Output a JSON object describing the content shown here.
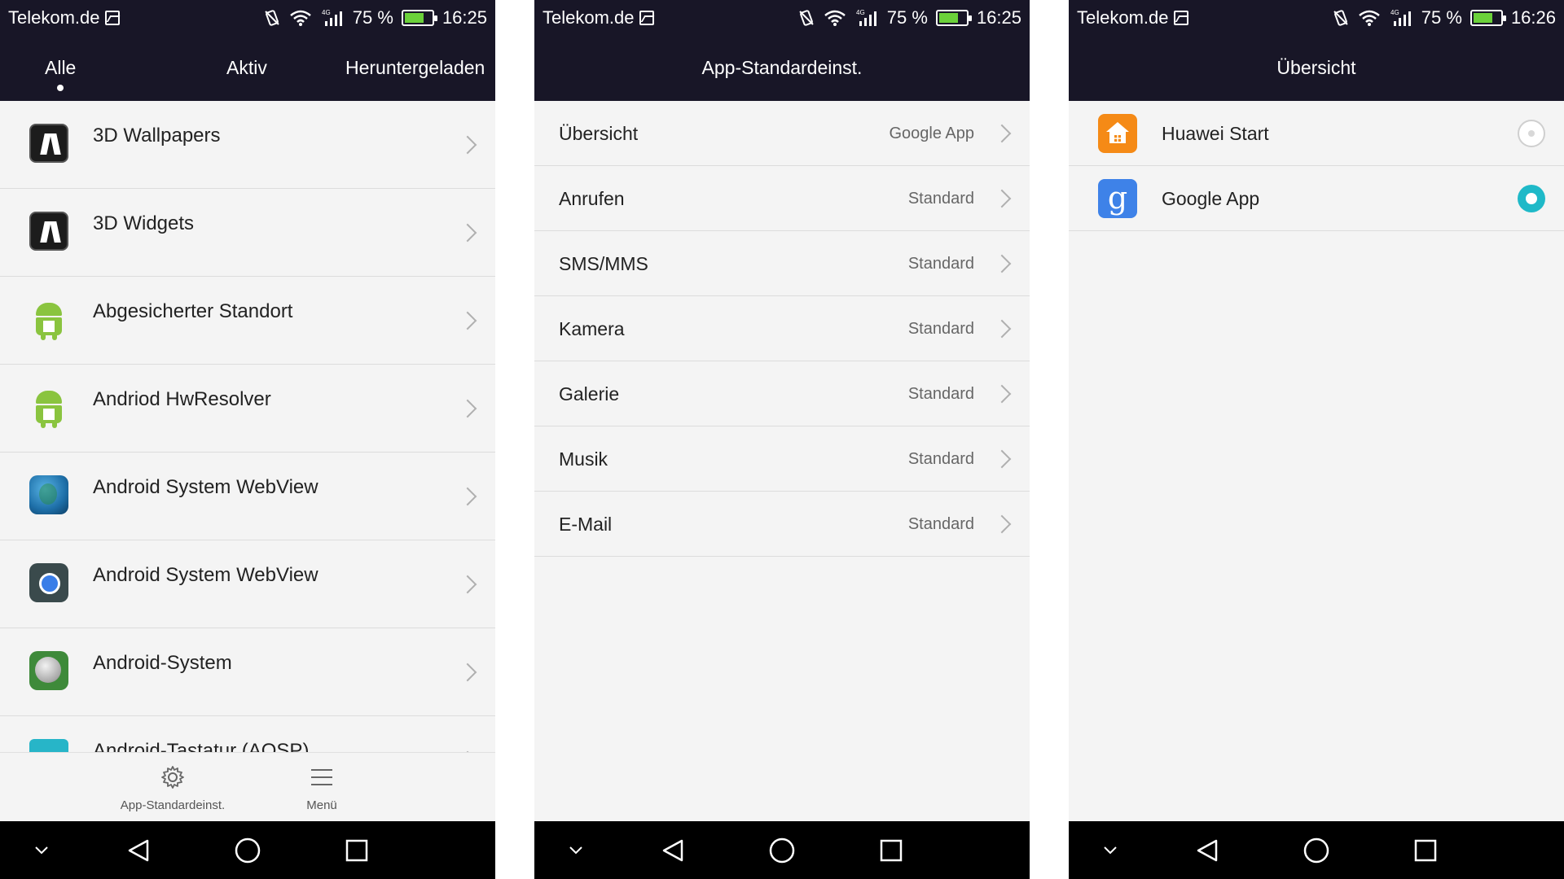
{
  "colors": {
    "topbar": "#181627",
    "background": "#f4f4f4",
    "radio_selected": "#1fb9c8",
    "battery_fill": "#6bd13a"
  },
  "screen1": {
    "status": {
      "carrier": "Telekom.de",
      "network": "4G",
      "battery": "75 %",
      "battery_level": 0.75,
      "time": "16:25"
    },
    "tabs": [
      {
        "label": "Alle",
        "selected": true
      },
      {
        "label": "Aktiv",
        "selected": false
      },
      {
        "label": "Heruntergeladen",
        "selected": false
      }
    ],
    "apps": [
      {
        "name": "3D Wallpapers",
        "icon": "wallpapers-app-icon"
      },
      {
        "name": "3D Widgets",
        "icon": "widgets-app-icon"
      },
      {
        "name": "Abgesicherter Standort",
        "icon": "android-robot-icon"
      },
      {
        "name": "Andriod HwResolver",
        "icon": "android-robot-icon"
      },
      {
        "name": "Android System WebView",
        "icon": "globe-icon"
      },
      {
        "name": "Android System WebView",
        "icon": "chrome-webview-icon"
      },
      {
        "name": "Android-System",
        "icon": "android-system-icon"
      },
      {
        "name": "Android-Tastatur (AOSP)",
        "icon": "keyboard-icon"
      }
    ],
    "actions": [
      {
        "label": "App-Standardeinst.",
        "icon": "gear-icon"
      },
      {
        "label": "Menü",
        "icon": "menu-icon"
      }
    ]
  },
  "screen2": {
    "status": {
      "carrier": "Telekom.de",
      "network": "4G",
      "battery": "75 %",
      "battery_level": 0.75,
      "time": "16:25"
    },
    "title": "App-Standardeinst.",
    "rows": [
      {
        "label": "Übersicht",
        "value": "Google App"
      },
      {
        "label": "Anrufen",
        "value": "Standard"
      },
      {
        "label": "SMS/MMS",
        "value": "Standard"
      },
      {
        "label": "Kamera",
        "value": "Standard"
      },
      {
        "label": "Galerie",
        "value": "Standard"
      },
      {
        "label": "Musik",
        "value": "Standard"
      },
      {
        "label": "E-Mail",
        "value": "Standard"
      }
    ]
  },
  "screen3": {
    "status": {
      "carrier": "Telekom.de",
      "network": "4G",
      "battery": "75 %",
      "battery_level": 0.75,
      "time": "16:26"
    },
    "title": "Übersicht",
    "options": [
      {
        "label": "Huawei Start",
        "icon": "huawei-home-icon",
        "selected": false
      },
      {
        "label": "Google App",
        "icon": "google-icon",
        "icon_glyph": "g",
        "selected": true
      }
    ]
  },
  "navbar": [
    "hide-nav-icon",
    "back-icon",
    "home-icon",
    "recents-icon"
  ]
}
